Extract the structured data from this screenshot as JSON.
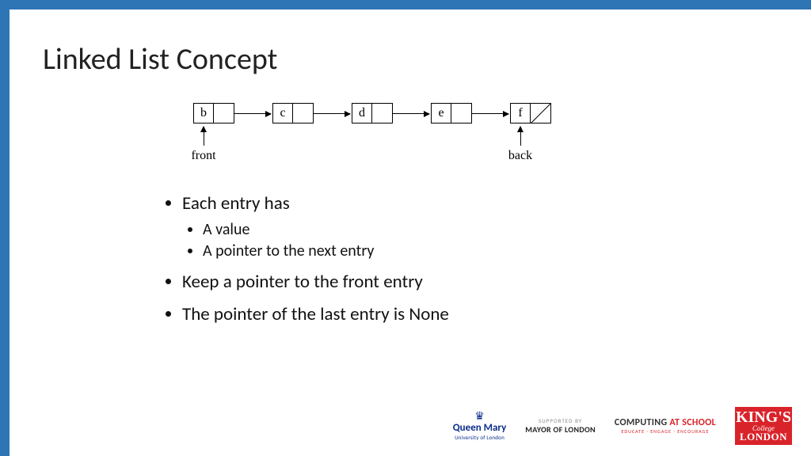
{
  "title": "Linked List Concept",
  "diagram": {
    "nodes": [
      "b",
      "c",
      "d",
      "e",
      "f"
    ],
    "front_label": "front",
    "back_label": "back"
  },
  "bullets": {
    "b1": "Each entry has",
    "b1a": "A value",
    "b1b": "A pointer to the next entry",
    "b2": "Keep a pointer to the front entry",
    "b3": "The pointer of the last entry is None"
  },
  "logos": {
    "qm_name": "Queen Mary",
    "qm_sub": "University of London",
    "mol_top": "SUPPORTED BY",
    "mol_main": "MAYOR OF LONDON",
    "cas_pre": "COMPUTING ",
    "cas_red": "AT SCHOOL",
    "cas_sub": "EDUCATE · ENGAGE · ENCOURAGE",
    "kcl_k": "KING'S",
    "kcl_coll": "College",
    "kcl_lon": "LONDON"
  }
}
